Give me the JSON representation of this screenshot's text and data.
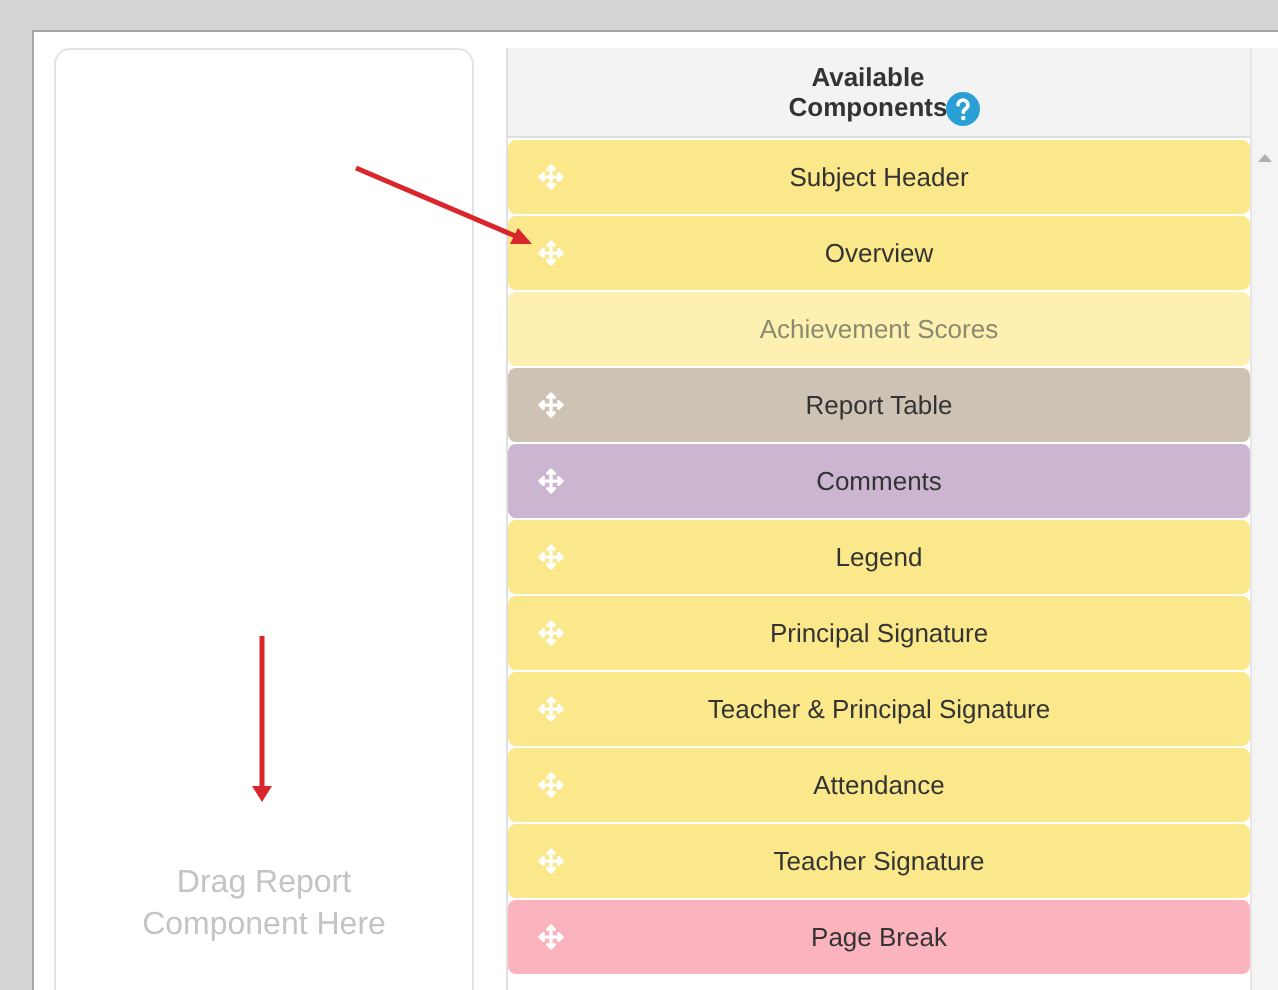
{
  "drop_zone": {
    "placeholder": "Drag Report Component Here"
  },
  "components_panel": {
    "title": "Available Components",
    "items": [
      {
        "label": "Subject Header",
        "kind": "draggable",
        "color": "#fbe88a"
      },
      {
        "label": "Overview",
        "kind": "draggable",
        "color": "#fbe88a"
      },
      {
        "label": "Achievement Scores",
        "kind": "disabled",
        "color": "#fdf0b0"
      },
      {
        "label": "Report Table",
        "kind": "draggable",
        "color": "#cdc2b3"
      },
      {
        "label": "Comments",
        "kind": "draggable",
        "color": "#cbb5d1"
      },
      {
        "label": "Legend",
        "kind": "draggable",
        "color": "#fbe88a"
      },
      {
        "label": "Principal Signature",
        "kind": "draggable",
        "color": "#fbe88a"
      },
      {
        "label": "Teacher & Principal Signature",
        "kind": "draggable",
        "color": "#fbe88a"
      },
      {
        "label": "Attendance",
        "kind": "draggable",
        "color": "#fbe88a"
      },
      {
        "label": "Teacher Signature",
        "kind": "draggable",
        "color": "#fbe88a"
      },
      {
        "label": "Page Break",
        "kind": "draggable",
        "color": "#fbb3bd"
      }
    ]
  }
}
